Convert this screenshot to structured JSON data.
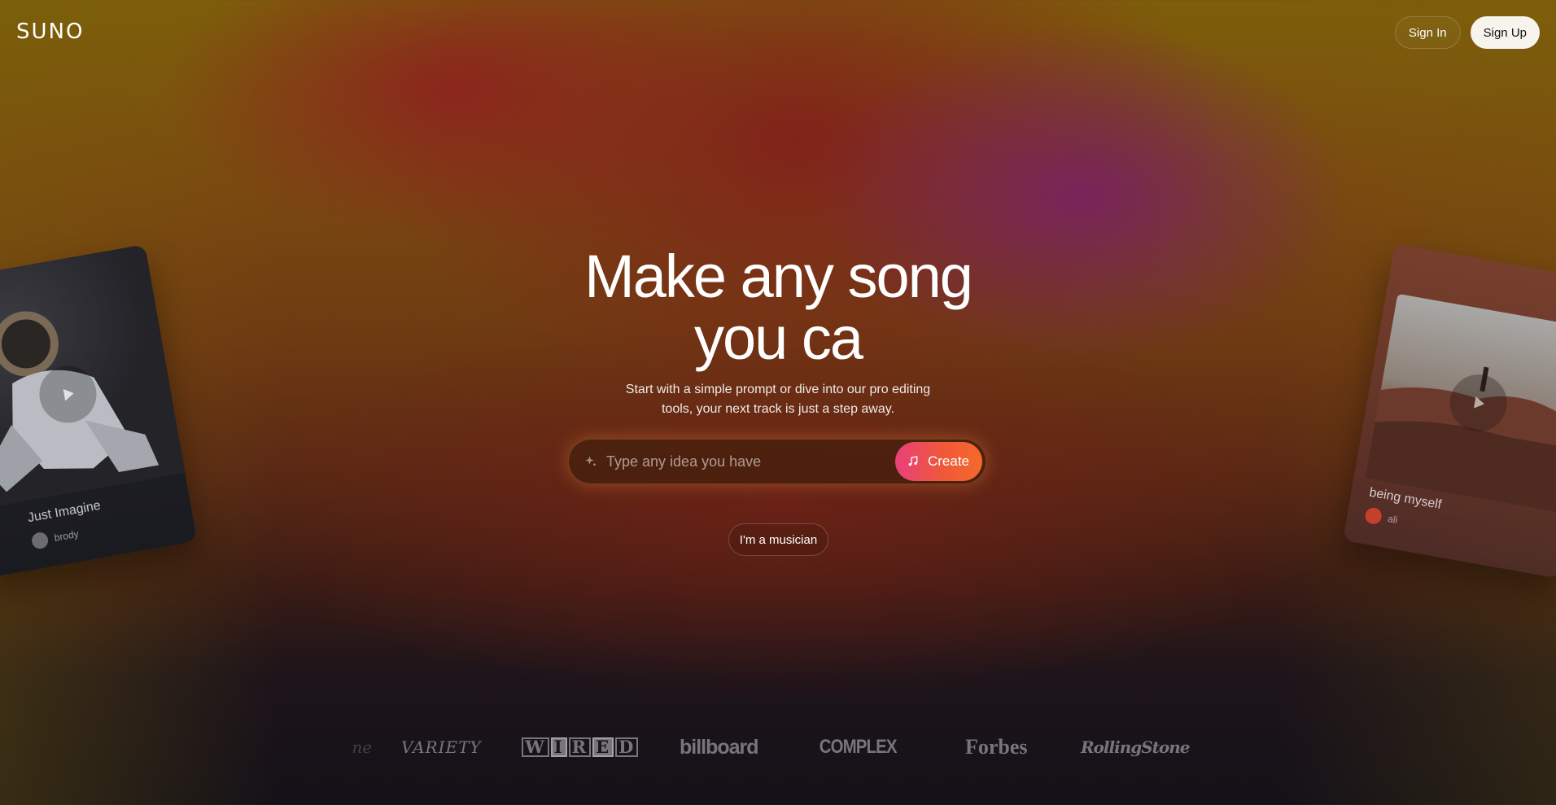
{
  "header": {
    "brand": "SUNO",
    "sign_in": "Sign In",
    "sign_up": "Sign Up"
  },
  "hero": {
    "headline_line1": "Make any song",
    "headline_line2": "you ca",
    "subtitle": "Start with a simple prompt or dive into our pro editing tools, your next track is just a step away.",
    "prompt_placeholder": "Type any idea you have",
    "create_label": "Create",
    "musician_label": "I'm a musician"
  },
  "cards": [
    {
      "title": "Just Imagine",
      "author": "brody"
    },
    {
      "title": "being myself",
      "author": "ali"
    }
  ],
  "press": {
    "items": [
      "ne",
      "VARIETY",
      "WIRED",
      "billboard",
      "COMPLEX",
      "Forbes",
      "RollingStone"
    ]
  },
  "colors": {
    "create_gradient_start": "#e9407a",
    "create_gradient_end": "#f46a2a",
    "signup_bg": "#f7f4ee"
  },
  "icons": [
    "sparkle-icon",
    "music-note-icon",
    "play-icon"
  ]
}
